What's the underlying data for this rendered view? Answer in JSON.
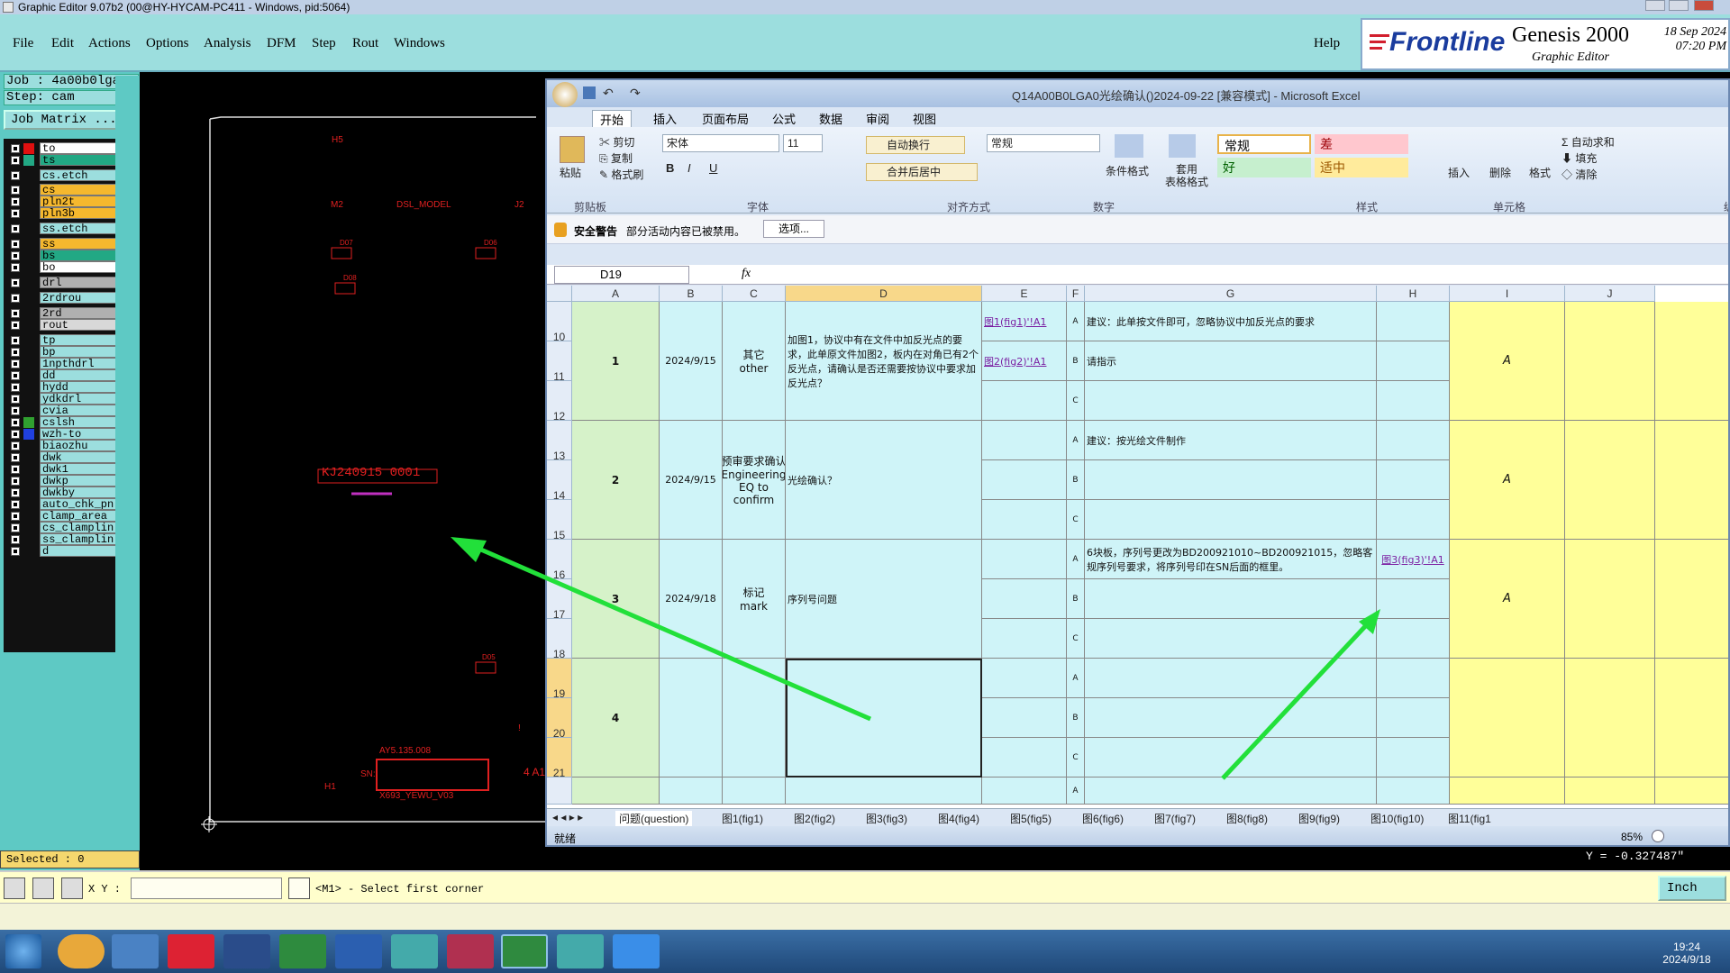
{
  "titlebar": {
    "title": "Graphic Editor 9.07b2 (00@HY-HYCAM-PC411 - Windows, pid:5064)"
  },
  "menu": [
    "File",
    "Edit",
    "Actions",
    "Options",
    "Analysis",
    "DFM",
    "Step",
    "Rout",
    "Windows"
  ],
  "help_label": "Help",
  "logo": {
    "brand": "Frontline",
    "product": "Genesis 2000",
    "subtitle": "Graphic Editor",
    "date": "18 Sep 2024",
    "time": "07:20 PM"
  },
  "job": {
    "job_line": "Job  : 4a00b0lga0",
    "step_line": "Step: cam",
    "matrix_label": "Job Matrix ..."
  },
  "layers": [
    {
      "name": "to",
      "color": "#ffffff",
      "swatch": "#e01010"
    },
    {
      "name": "ts",
      "color": "#22a884",
      "swatch": "#22a884"
    },
    {
      "name": "cs.etch",
      "color": "#9cdede",
      "swatch": ""
    },
    {
      "name": "cs",
      "color": "#f5b82e",
      "swatch": ""
    },
    {
      "name": "pln2t",
      "color": "#f5b82e",
      "swatch": ""
    },
    {
      "name": "pln3b",
      "color": "#f5b82e",
      "swatch": ""
    },
    {
      "name": "ss.etch",
      "color": "#9cdede",
      "swatch": ""
    },
    {
      "name": "ss",
      "color": "#f5b82e",
      "swatch": ""
    },
    {
      "name": "bs",
      "color": "#22a884",
      "swatch": ""
    },
    {
      "name": "bo",
      "color": "#ffffff",
      "swatch": ""
    },
    {
      "name": "drl",
      "color": "#b0b0b0",
      "swatch": ""
    },
    {
      "name": "2rdrou",
      "color": "#9cdede",
      "swatch": ""
    },
    {
      "name": "2rd",
      "color": "#b0b0b0",
      "swatch": ""
    },
    {
      "name": "rout",
      "color": "#d8d8d8",
      "swatch": ""
    },
    {
      "name": "tp",
      "color": "#9cdede",
      "swatch": ""
    },
    {
      "name": "bp",
      "color": "#9cdede",
      "swatch": ""
    },
    {
      "name": "1npthdrl",
      "color": "#9cdede",
      "swatch": ""
    },
    {
      "name": "dd",
      "color": "#9cdede",
      "swatch": ""
    },
    {
      "name": "hydd",
      "color": "#9cdede",
      "swatch": ""
    },
    {
      "name": "ydkdrl",
      "color": "#9cdede",
      "swatch": ""
    },
    {
      "name": "cvia",
      "color": "#9cdede",
      "swatch": ""
    },
    {
      "name": "cslsh",
      "color": "#9cdede",
      "swatch": "#30a030"
    },
    {
      "name": "wzh-to",
      "color": "#9cdede",
      "swatch": "#2040e0"
    },
    {
      "name": "biaozhu",
      "color": "#9cdede",
      "swatch": ""
    },
    {
      "name": "dwk",
      "color": "#9cdede",
      "swatch": ""
    },
    {
      "name": "dwk1",
      "color": "#9cdede",
      "swatch": ""
    },
    {
      "name": "dwkp",
      "color": "#9cdede",
      "swatch": ""
    },
    {
      "name": "dwkby",
      "color": "#9cdede",
      "swatch": ""
    },
    {
      "name": "auto_chk_pn",
      "color": "#9cdede",
      "swatch": ""
    },
    {
      "name": "clamp_area",
      "color": "#9cdede",
      "swatch": ""
    },
    {
      "name": "cs_clamplin",
      "color": "#9cdede",
      "swatch": ""
    },
    {
      "name": "ss_clamplin",
      "color": "#9cdede",
      "swatch": ""
    },
    {
      "name": "d",
      "color": "#9cdede",
      "swatch": ""
    }
  ],
  "canvas_labels": {
    "h5": "H5",
    "m2": "M2",
    "dsl": "DSL_MODEL",
    "j2": "J2",
    "d07": "D07",
    "d06": "D06",
    "d_left": "D08",
    "barcode": "KJ240915 0001",
    "d05": "D05",
    "ay": "AY5.135.008",
    "sn": "SN:",
    "x693": "X693_YEWU_V03",
    "h1": "H1",
    "a1": "4 A1",
    "exclam": "!"
  },
  "selected": "Selected : 0",
  "y_readout": "Y = -0.327487\"",
  "cmd": {
    "xy_label": "X Y :",
    "xy_value": "",
    "prompt": "<M1> - Select first corner",
    "unit": "Inch"
  },
  "clock": {
    "time": "19:24",
    "date": "2024/9/18"
  },
  "excel": {
    "title": "Q14A00B0LGA0光绘确认()2024-09-22  [兼容模式]  -  Microsoft Excel",
    "tabs": [
      "开始",
      "插入",
      "页面布局",
      "公式",
      "数据",
      "审阅",
      "视图"
    ],
    "ribbon": {
      "paste": "粘贴",
      "cut": "剪切",
      "copy": "复制",
      "format_painter": "格式刷",
      "font": "宋体",
      "size": "11",
      "wrap": "自动换行",
      "merge": "合并后居中",
      "number_format": "常规",
      "cond_fmt": "条件格式",
      "table_fmt": "套用\n表格格式",
      "style_normal": "常规",
      "style_bad": "差",
      "style_good": "好",
      "style_neutral": "适中",
      "insert": "插入",
      "delete": "删除",
      "format": "格式",
      "autosum": "自动求和",
      "fill": "填充",
      "clear": "清除",
      "groups": [
        "剪贴板",
        "字体",
        "对齐方式",
        "数字",
        "样式",
        "单元格",
        "编"
      ]
    },
    "warning": {
      "title": "安全警告",
      "text": "部分活动内容已被禁用。",
      "button": "选项..."
    },
    "namebox": "D19",
    "columns": [
      "A",
      "B",
      "C",
      "D",
      "E",
      "F",
      "G",
      "H",
      "I",
      "J"
    ],
    "rows": [
      "10",
      "11",
      "12",
      "13",
      "14",
      "15",
      "16",
      "17",
      "18",
      "19",
      "20",
      "21"
    ],
    "issues": [
      {
        "no": "1",
        "date": "2024/9/15",
        "type": "其它\nother",
        "desc": "加图1，协议中有在文件中加反光点的要求，此单原文件加图2，板内在对角已有2个反光点，请确认是否还需要按协议中要求加反光点？",
        "links": [
          "图1(fig1)'!A1",
          "图2(fig2)'!A1",
          ""
        ],
        "options": [
          "建议：此单按文件即可，忽略协议中加反光点的要求",
          "请指示",
          ""
        ],
        "h_link": "",
        "result": "A"
      },
      {
        "no": "2",
        "date": "2024/9/15",
        "type": "预审要求确认\nEngineering EQ to confirm",
        "desc": "光绘确认？",
        "links": [
          "",
          "",
          ""
        ],
        "options": [
          "建议：按光绘文件制作",
          "",
          ""
        ],
        "h_link": "",
        "result": "A"
      },
      {
        "no": "3",
        "date": "2024/9/18",
        "type": "标记\nmark",
        "desc": "序列号问题",
        "links": [
          "",
          "",
          ""
        ],
        "options": [
          "6块板，序列号更改为BD200921010~BD200921015，忽略客规序列号要求，将序列号印在SN后面的框里。",
          "",
          ""
        ],
        "h_link": "图3(fig3)'!A1",
        "result": "A"
      },
      {
        "no": "4",
        "date": "",
        "type": "",
        "desc": "",
        "links": [
          "",
          "",
          ""
        ],
        "options": [
          "",
          "",
          ""
        ],
        "h_link": "",
        "result": ""
      }
    ],
    "abc": [
      "A",
      "B",
      "C"
    ],
    "sheets": [
      "问题(question)",
      "图1(fig1)",
      "图2(fig2)",
      "图3(fig3)",
      "图4(fig4)",
      "图5(fig5)",
      "图6(fig6)",
      "图7(fig7)",
      "图8(fig8)",
      "图9(fig9)",
      "图10(fig10)",
      "图11(fig1"
    ],
    "status": "就绪",
    "zoom": "85%"
  }
}
